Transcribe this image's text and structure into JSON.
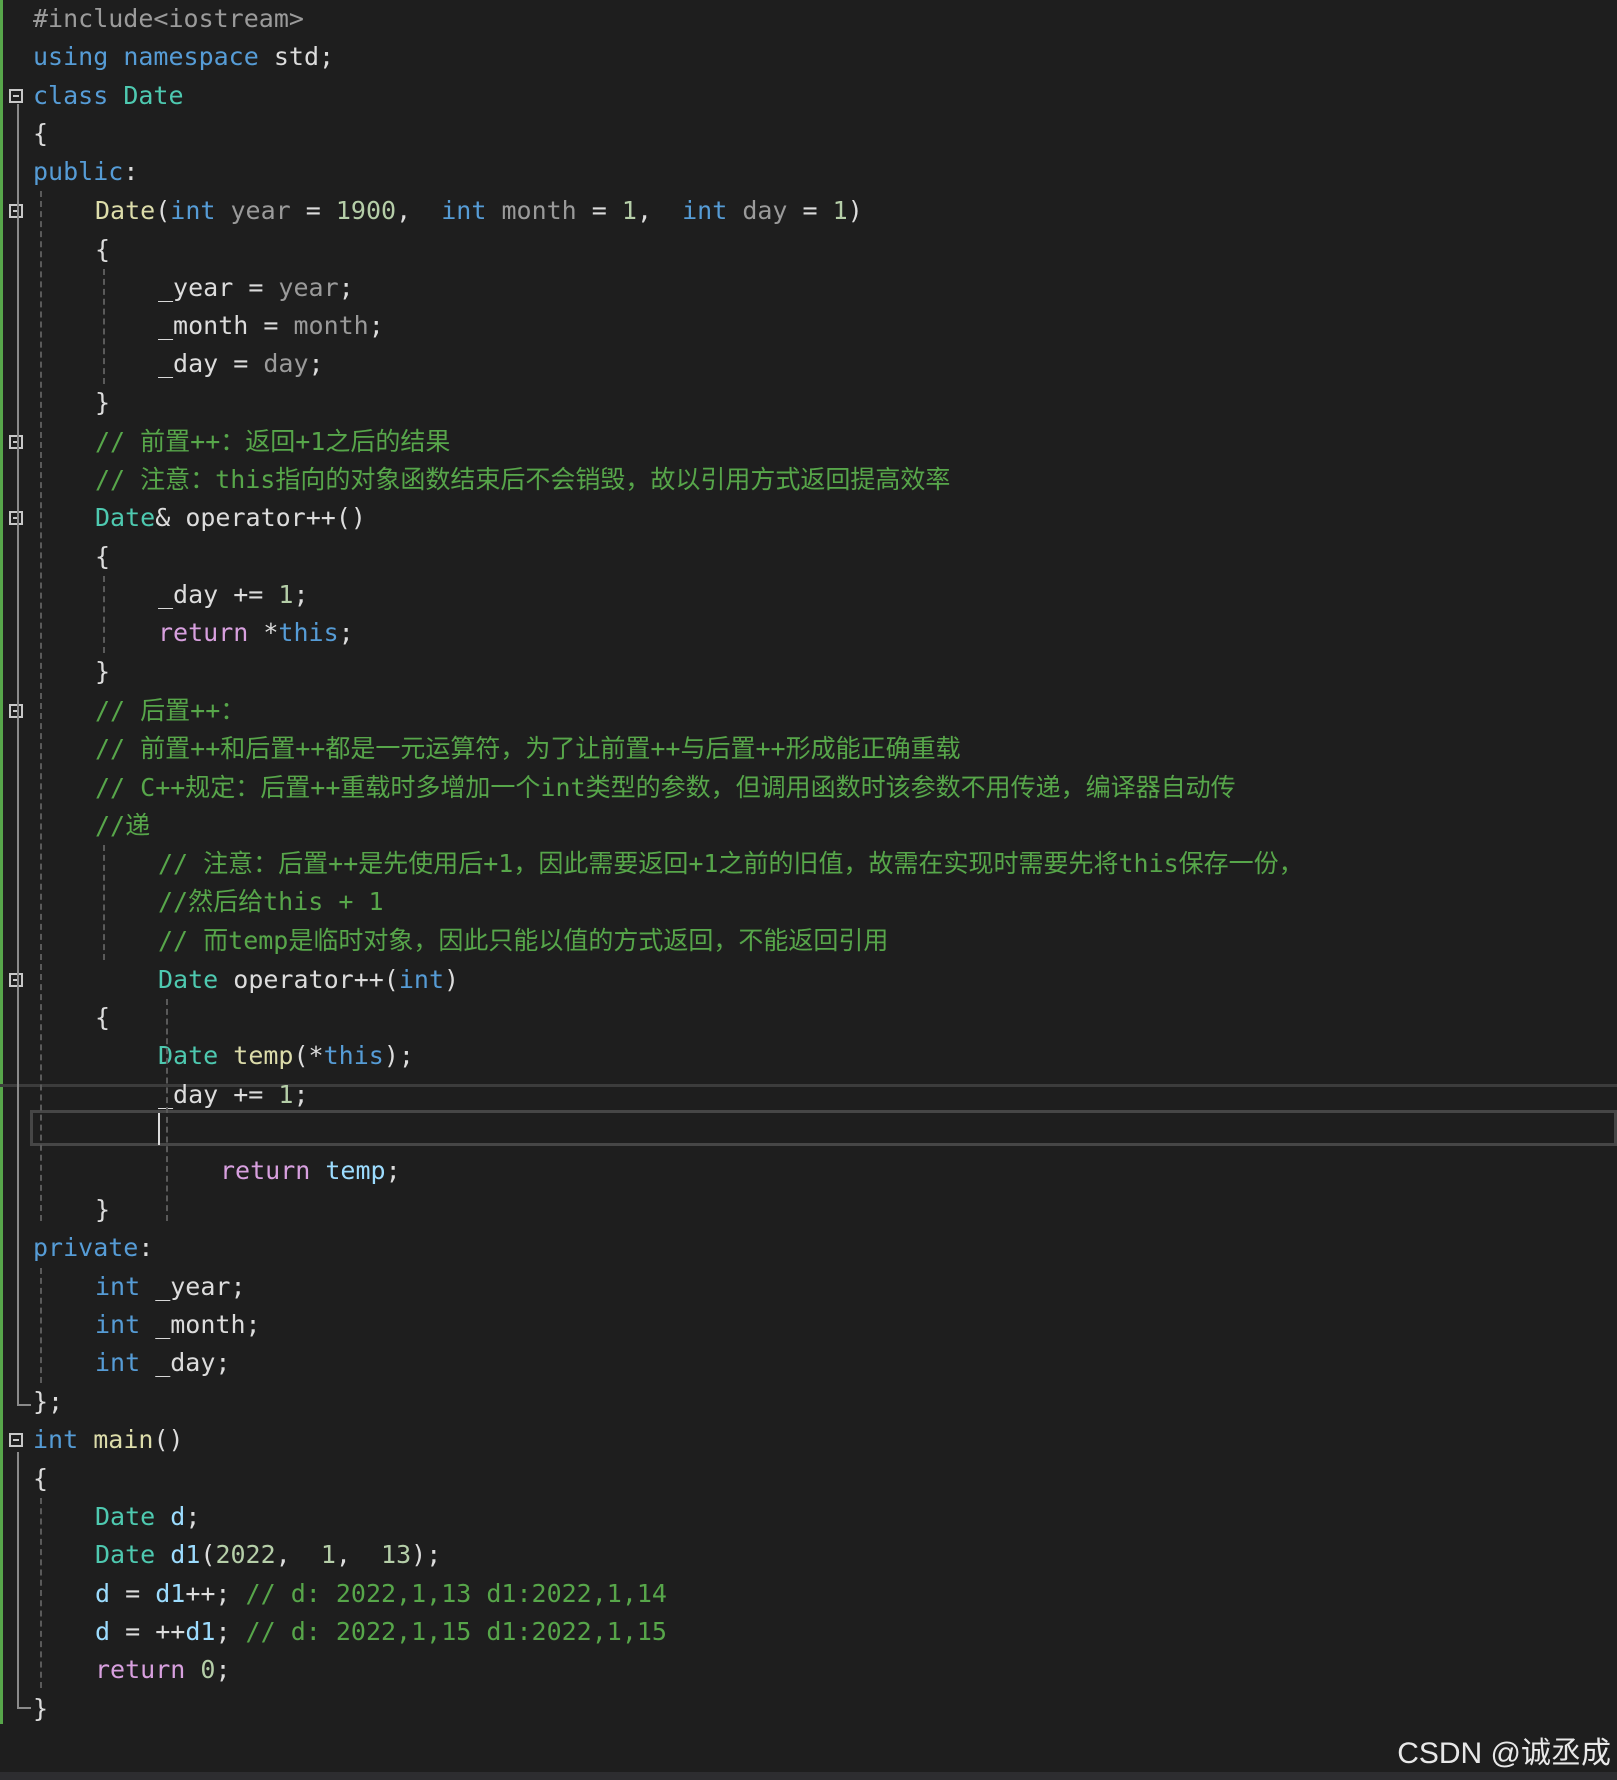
{
  "editor": {
    "lines": [
      {
        "id": "l1",
        "tokens": [
          {
            "t": "#include<iostream>",
            "c": "pp"
          }
        ]
      },
      {
        "id": "l2",
        "tokens": [
          {
            "t": "using",
            "c": "kw"
          },
          {
            "t": " ",
            "c": ""
          },
          {
            "t": "namespace",
            "c": "kw"
          },
          {
            "t": " std;",
            "c": ""
          }
        ]
      },
      {
        "id": "l3",
        "tokens": [
          {
            "t": "class",
            "c": "kw"
          },
          {
            "t": " ",
            "c": ""
          },
          {
            "t": "Date",
            "c": "ty"
          }
        ]
      },
      {
        "id": "l4",
        "tokens": [
          {
            "t": "{",
            "c": ""
          }
        ]
      },
      {
        "id": "l5",
        "tokens": [
          {
            "t": "public",
            "c": "kw"
          },
          {
            "t": ":",
            "c": ""
          }
        ]
      },
      {
        "id": "l6",
        "tokens": [
          {
            "t": "Date",
            "c": "fn"
          },
          {
            "t": "(",
            "c": ""
          },
          {
            "t": "int",
            "c": "kw"
          },
          {
            "t": " ",
            "c": ""
          },
          {
            "t": "year",
            "c": "pa"
          },
          {
            "t": " = ",
            "c": ""
          },
          {
            "t": "1900",
            "c": "nm"
          },
          {
            "t": ",  ",
            "c": ""
          },
          {
            "t": "int",
            "c": "kw"
          },
          {
            "t": " ",
            "c": ""
          },
          {
            "t": "month",
            "c": "pa"
          },
          {
            "t": " = ",
            "c": ""
          },
          {
            "t": "1",
            "c": "nm"
          },
          {
            "t": ",  ",
            "c": ""
          },
          {
            "t": "int",
            "c": "kw"
          },
          {
            "t": " ",
            "c": ""
          },
          {
            "t": "day",
            "c": "pa"
          },
          {
            "t": " = ",
            "c": ""
          },
          {
            "t": "1",
            "c": "nm"
          },
          {
            "t": ")",
            "c": ""
          }
        ]
      },
      {
        "id": "l7",
        "tokens": [
          {
            "t": "{",
            "c": ""
          }
        ]
      },
      {
        "id": "l8",
        "tokens": [
          {
            "t": "_year",
            "c": ""
          },
          {
            "t": " = ",
            "c": ""
          },
          {
            "t": "year",
            "c": "pa"
          },
          {
            "t": ";",
            "c": ""
          }
        ]
      },
      {
        "id": "l9",
        "tokens": [
          {
            "t": "_month",
            "c": ""
          },
          {
            "t": " = ",
            "c": ""
          },
          {
            "t": "month",
            "c": "pa"
          },
          {
            "t": ";",
            "c": ""
          }
        ]
      },
      {
        "id": "l10",
        "tokens": [
          {
            "t": "_day",
            "c": ""
          },
          {
            "t": " = ",
            "c": ""
          },
          {
            "t": "day",
            "c": "pa"
          },
          {
            "t": ";",
            "c": ""
          }
        ]
      },
      {
        "id": "l11",
        "tokens": [
          {
            "t": "}",
            "c": ""
          }
        ]
      },
      {
        "id": "l12",
        "tokens": [
          {
            "t": "// 前置++：返回+1之后的结果",
            "c": "cm"
          }
        ]
      },
      {
        "id": "l13",
        "tokens": [
          {
            "t": "// 注意：this指向的对象函数结束后不会销毁，故以引用方式返回提高效率",
            "c": "cm"
          }
        ]
      },
      {
        "id": "l14",
        "tokens": [
          {
            "t": "Date",
            "c": "ty"
          },
          {
            "t": "& operator++()",
            "c": ""
          }
        ]
      },
      {
        "id": "l15",
        "tokens": [
          {
            "t": "{",
            "c": ""
          }
        ]
      },
      {
        "id": "l16",
        "tokens": [
          {
            "t": "_day += ",
            "c": ""
          },
          {
            "t": "1",
            "c": "nm"
          },
          {
            "t": ";",
            "c": ""
          }
        ]
      },
      {
        "id": "l17",
        "tokens": [
          {
            "t": "return",
            "c": "ct"
          },
          {
            "t": " *",
            "c": ""
          },
          {
            "t": "this",
            "c": "kw"
          },
          {
            "t": ";",
            "c": ""
          }
        ]
      },
      {
        "id": "l18",
        "tokens": [
          {
            "t": "}",
            "c": ""
          }
        ]
      },
      {
        "id": "l19",
        "tokens": [
          {
            "t": "// 后置++：",
            "c": "cm"
          }
        ]
      },
      {
        "id": "l20",
        "tokens": [
          {
            "t": "// 前置++和后置++都是一元运算符，为了让前置++与后置++形成能正确重载",
            "c": "cm"
          }
        ]
      },
      {
        "id": "l21",
        "tokens": [
          {
            "t": "// C++规定：后置++重载时多增加一个int类型的参数，但调用函数时该参数不用传递，编译器自动传",
            "c": "cm"
          }
        ]
      },
      {
        "id": "l22",
        "tokens": [
          {
            "t": "//递",
            "c": "cm"
          }
        ]
      },
      {
        "id": "l23",
        "tokens": [
          {
            "t": "// 注意：后置++是先使用后+1，因此需要返回+1之前的旧值，故需在实现时需要先将this保存一份，",
            "c": "cm"
          }
        ]
      },
      {
        "id": "l24",
        "tokens": [
          {
            "t": "//然后给this + 1",
            "c": "cm"
          }
        ]
      },
      {
        "id": "l25",
        "tokens": [
          {
            "t": "// 而temp是临时对象，因此只能以值的方式返回，不能返回引用",
            "c": "cm"
          }
        ]
      },
      {
        "id": "l26",
        "tokens": [
          {
            "t": "Date",
            "c": "ty"
          },
          {
            "t": " ",
            "c": ""
          },
          {
            "t": "operator++",
            "c": ""
          },
          {
            "t": "(",
            "c": ""
          },
          {
            "t": "int",
            "c": "kw"
          },
          {
            "t": ")",
            "c": ""
          }
        ]
      },
      {
        "id": "l27",
        "tokens": [
          {
            "t": "{",
            "c": ""
          }
        ]
      },
      {
        "id": "l28",
        "tokens": [
          {
            "t": "Date",
            "c": "ty"
          },
          {
            "t": " ",
            "c": ""
          },
          {
            "t": "temp",
            "c": "fn"
          },
          {
            "t": "(*",
            "c": ""
          },
          {
            "t": "this",
            "c": "kw"
          },
          {
            "t": ");",
            "c": ""
          }
        ]
      },
      {
        "id": "l29",
        "tokens": [
          {
            "t": "_day += ",
            "c": ""
          },
          {
            "t": "1",
            "c": "nm"
          },
          {
            "t": ";",
            "c": ""
          }
        ]
      },
      {
        "id": "l30",
        "tokens": [
          {
            "t": "",
            "c": ""
          }
        ]
      },
      {
        "id": "l31",
        "tokens": [
          {
            "t": "return",
            "c": "ct"
          },
          {
            "t": " ",
            "c": ""
          },
          {
            "t": "temp",
            "c": "ms"
          },
          {
            "t": ";",
            "c": ""
          }
        ]
      },
      {
        "id": "l32",
        "tokens": [
          {
            "t": "}",
            "c": ""
          }
        ]
      },
      {
        "id": "l33",
        "tokens": [
          {
            "t": "private",
            "c": "kw"
          },
          {
            "t": ":",
            "c": ""
          }
        ]
      },
      {
        "id": "l34",
        "tokens": [
          {
            "t": "int",
            "c": "kw"
          },
          {
            "t": " _year;",
            "c": ""
          }
        ]
      },
      {
        "id": "l35",
        "tokens": [
          {
            "t": "int",
            "c": "kw"
          },
          {
            "t": " _month;",
            "c": ""
          }
        ]
      },
      {
        "id": "l36",
        "tokens": [
          {
            "t": "int",
            "c": "kw"
          },
          {
            "t": " _day;",
            "c": ""
          }
        ]
      },
      {
        "id": "l37",
        "tokens": [
          {
            "t": "};",
            "c": ""
          }
        ]
      },
      {
        "id": "l38",
        "tokens": [
          {
            "t": "int",
            "c": "kw"
          },
          {
            "t": " ",
            "c": ""
          },
          {
            "t": "main",
            "c": "fn"
          },
          {
            "t": "()",
            "c": ""
          }
        ]
      },
      {
        "id": "l39",
        "tokens": [
          {
            "t": "{",
            "c": ""
          }
        ]
      },
      {
        "id": "l40",
        "tokens": [
          {
            "t": "Date",
            "c": "ty"
          },
          {
            "t": " ",
            "c": ""
          },
          {
            "t": "d",
            "c": "ms"
          },
          {
            "t": ";",
            "c": ""
          }
        ]
      },
      {
        "id": "l41",
        "tokens": [
          {
            "t": "Date",
            "c": "ty"
          },
          {
            "t": " ",
            "c": ""
          },
          {
            "t": "d1",
            "c": "ms"
          },
          {
            "t": "(",
            "c": ""
          },
          {
            "t": "2022",
            "c": "nm"
          },
          {
            "t": ",  ",
            "c": ""
          },
          {
            "t": "1",
            "c": "nm"
          },
          {
            "t": ",  ",
            "c": ""
          },
          {
            "t": "13",
            "c": "nm"
          },
          {
            "t": ");",
            "c": ""
          }
        ]
      },
      {
        "id": "l42",
        "tokens": [
          {
            "t": "d",
            "c": "ms"
          },
          {
            "t": " = ",
            "c": ""
          },
          {
            "t": "d1",
            "c": "ms"
          },
          {
            "t": "++; ",
            "c": ""
          },
          {
            "t": "// d: 2022,1,13 d1:2022,1,14",
            "c": "cm"
          }
        ]
      },
      {
        "id": "l43",
        "tokens": [
          {
            "t": "d",
            "c": "ms"
          },
          {
            "t": " = ++",
            "c": ""
          },
          {
            "t": "d1",
            "c": "ms"
          },
          {
            "t": "; ",
            "c": ""
          },
          {
            "t": "// d: 2022,1,15 d1:2022,1,15",
            "c": "cm"
          }
        ]
      },
      {
        "id": "l44",
        "tokens": [
          {
            "t": "return",
            "c": "ct"
          },
          {
            "t": " ",
            "c": ""
          },
          {
            "t": "0",
            "c": "nm"
          },
          {
            "t": ";",
            "c": ""
          }
        ]
      },
      {
        "id": "l45",
        "tokens": [
          {
            "t": "}",
            "c": ""
          }
        ]
      }
    ]
  },
  "watermark": "CSDN @诚丞成"
}
